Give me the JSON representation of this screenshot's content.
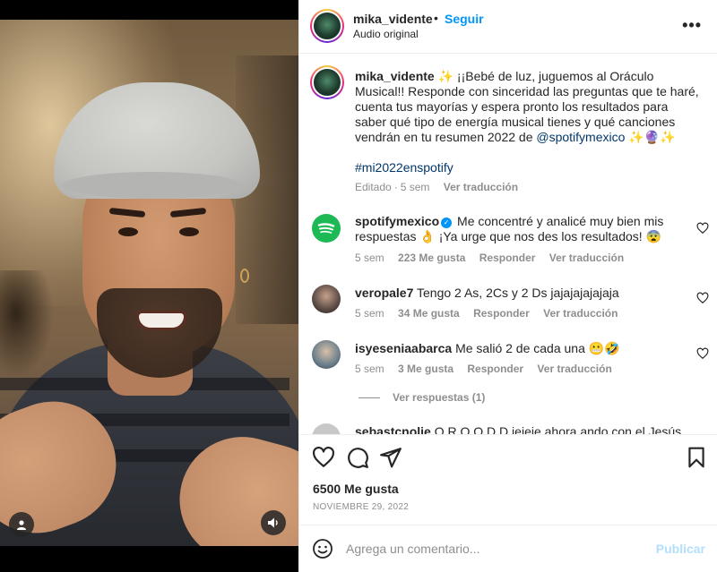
{
  "post": {
    "username": "mika_vidente",
    "follow_label": "Seguir",
    "audio_label": "Audio original",
    "more_icon": "more-horizontal-icon",
    "separator": "•"
  },
  "caption": {
    "username": "mika_vidente",
    "text_before_mention": "✨ ¡¡Bebé de luz, juguemos al Oráculo Musical!! Responde con sinceridad las preguntas que te haré, cuenta tus mayorías y espera pronto los resultados para saber qué tipo de energía musical tienes y qué canciones vendrán en tu resumen 2022 de ",
    "mention": "@spotifymexico",
    "text_after_mention": " ✨🔮✨",
    "hashtag": "#mi2022enspotify",
    "edited": "Editado",
    "meta_sep": "·",
    "time": "5 sem",
    "translate": "Ver traducción"
  },
  "comments": [
    {
      "username": "spotifymexico",
      "verified": true,
      "text": "Me concentré y analicé muy bien mis respuestas 👌 ¡Ya urge que nos des los resultados! 😨",
      "time": "5 sem",
      "likes": "223 Me gusta",
      "reply": "Responder",
      "translate": "Ver traducción",
      "avatar_color": "#1db954"
    },
    {
      "username": "veropale7",
      "verified": false,
      "text": "Tengo 2 As, 2Cs y 2 Ds jajajajajajaja",
      "time": "5 sem",
      "likes": "34 Me gusta",
      "reply": "Responder",
      "translate": "Ver traducción",
      "avatar_color": "#5a4a44"
    },
    {
      "username": "isyeseniaabarca",
      "verified": false,
      "text": "Me salió 2 de cada una 😬🤣",
      "time": "5 sem",
      "likes": "3 Me gusta",
      "reply": "Responder",
      "translate": "Ver traducción",
      "avatar_color": "#6b7f8c"
    }
  ],
  "view_replies": "Ver respuestas (1)",
  "partial_comment": {
    "username": "sebastcnolie",
    "text": "Q R Q Q D D jejeje ahora ando con el Jesús"
  },
  "actions": {
    "like_icon": "heart-icon",
    "comment_icon": "comment-bubble-icon",
    "share_icon": "paper-plane-icon",
    "save_icon": "bookmark-icon",
    "likes_count": "6500 Me gusta",
    "date": "NOVIEMBRE 29, 2022"
  },
  "comment_bar": {
    "emoji_icon": "smiley-icon",
    "placeholder": "Agrega un comentario...",
    "publish_label": "Publicar"
  },
  "colors": {
    "link_blue": "#0095f6",
    "mention_blue": "#00376b",
    "muted": "#8e8e8e",
    "publish_disabled": "#b2dffc"
  }
}
